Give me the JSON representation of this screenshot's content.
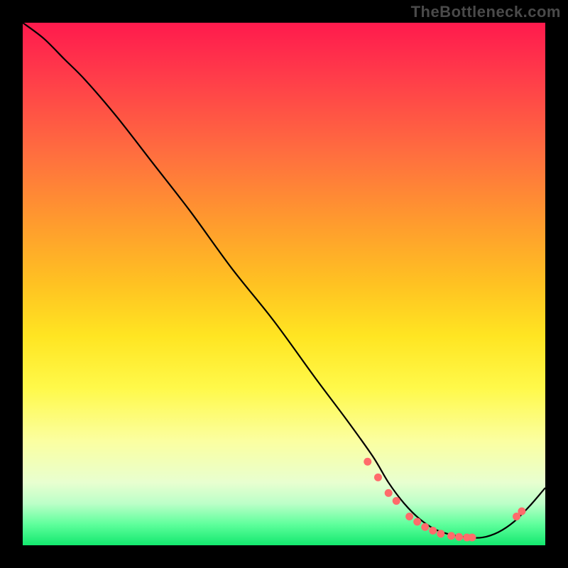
{
  "watermark": "TheBottleneck.com",
  "chart_data": {
    "type": "line",
    "title": "",
    "xlabel": "",
    "ylabel": "",
    "xlim": [
      0,
      100
    ],
    "ylim": [
      0,
      100
    ],
    "grid": false,
    "legend": false,
    "series": [
      {
        "name": "curve",
        "x": [
          0,
          4,
          8,
          12,
          18,
          25,
          32,
          40,
          48,
          56,
          62,
          67,
          70,
          73,
          76,
          79,
          82,
          85,
          88,
          91,
          94,
          97,
          100
        ],
        "y": [
          100,
          97,
          93,
          89,
          82,
          73,
          64,
          53,
          43,
          32,
          24,
          17,
          12,
          8,
          5,
          3,
          2,
          1.5,
          1.5,
          2.5,
          4.5,
          7.5,
          11
        ]
      }
    ],
    "points": {
      "name": "markers",
      "x": [
        66,
        68,
        70,
        71.5,
        74,
        75.5,
        77,
        78.5,
        80,
        82,
        83.5,
        85,
        86,
        94.5,
        95.5
      ],
      "y": [
        16,
        13,
        10,
        8.5,
        5.5,
        4.5,
        3.5,
        2.8,
        2.2,
        1.8,
        1.6,
        1.5,
        1.5,
        5.5,
        6.5
      ]
    },
    "background_gradient": {
      "top": "#ff1a4d",
      "mid": "#fff94a",
      "bottom": "#13e86e"
    }
  }
}
